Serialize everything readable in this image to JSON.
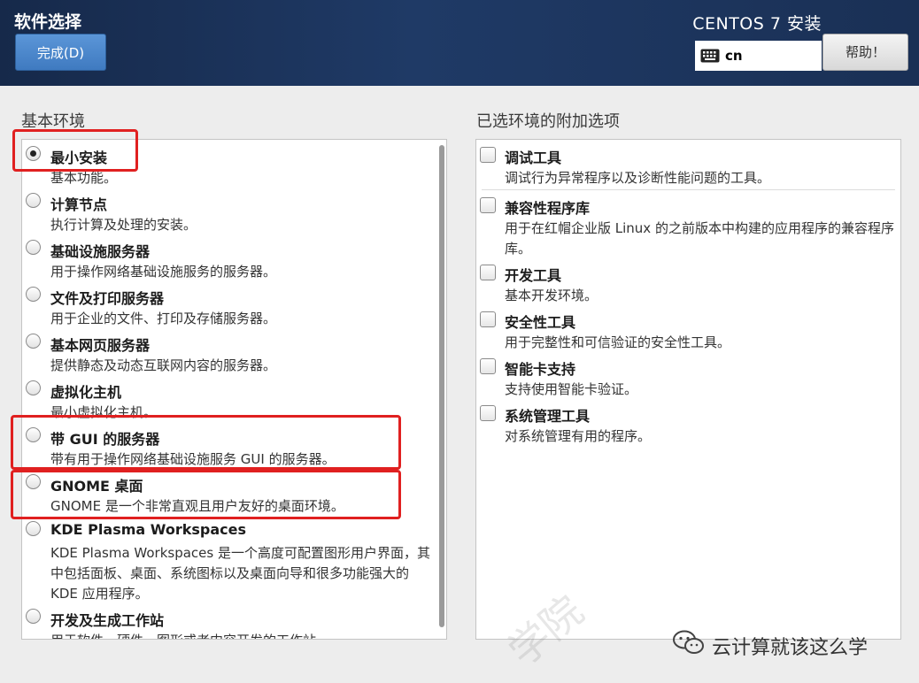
{
  "header": {
    "page_title": "软件选择",
    "done_button": "完成(D)",
    "product_title": "CENTOS 7 安装",
    "keyboard_layout": "cn",
    "help_button": "帮助！"
  },
  "base_environment": {
    "title": "基本环境",
    "selected_index": 0,
    "items": [
      {
        "label": "最小安装",
        "desc": "基本功能。",
        "selected": true
      },
      {
        "label": "计算节点",
        "desc": "执行计算及处理的安装。",
        "selected": false
      },
      {
        "label": "基础设施服务器",
        "desc": "用于操作网络基础设施服务的服务器。",
        "selected": false
      },
      {
        "label": "文件及打印服务器",
        "desc": "用于企业的文件、打印及存储服务器。",
        "selected": false
      },
      {
        "label": "基本网页服务器",
        "desc": "提供静态及动态互联网内容的服务器。",
        "selected": false
      },
      {
        "label": "虚拟化主机",
        "desc": "最小虚拟化主机。",
        "selected": false
      },
      {
        "label": "带 GUI 的服务器",
        "desc": "带有用于操作网络基础设施服务 GUI 的服务器。",
        "selected": false
      },
      {
        "label": "GNOME 桌面",
        "desc": "GNOME 是一个非常直观且用户友好的桌面环境。",
        "selected": false
      },
      {
        "label": "KDE Plasma Workspaces",
        "desc": "KDE Plasma Workspaces 是一个高度可配置图形用户界面，其中包括面板、桌面、系统图标以及桌面向导和很多功能强大的 KDE 应用程序。",
        "selected": false
      },
      {
        "label": "开发及生成工作站",
        "desc": "用于软件、硬件、图形或者内容开发的工作站。",
        "selected": false
      }
    ]
  },
  "addons": {
    "title": "已选环境的附加选项",
    "items": [
      {
        "label": "调试工具",
        "desc": "调试行为异常程序以及诊断性能问题的工具。",
        "checked": false
      },
      {
        "label": "兼容性程序库",
        "desc": "用于在红帽企业版 Linux 的之前版本中构建的应用程序的兼容程序库。",
        "checked": false
      },
      {
        "label": "开发工具",
        "desc": "基本开发环境。",
        "checked": false
      },
      {
        "label": "安全性工具",
        "desc": "用于完整性和可信验证的安全性工具。",
        "checked": false
      },
      {
        "label": "智能卡支持",
        "desc": "支持使用智能卡验证。",
        "checked": false
      },
      {
        "label": "系统管理工具",
        "desc": "对系统管理有用的程序。",
        "checked": false
      }
    ]
  },
  "watermark": {
    "text": "云计算就该这么学",
    "faint_text": "学院"
  }
}
